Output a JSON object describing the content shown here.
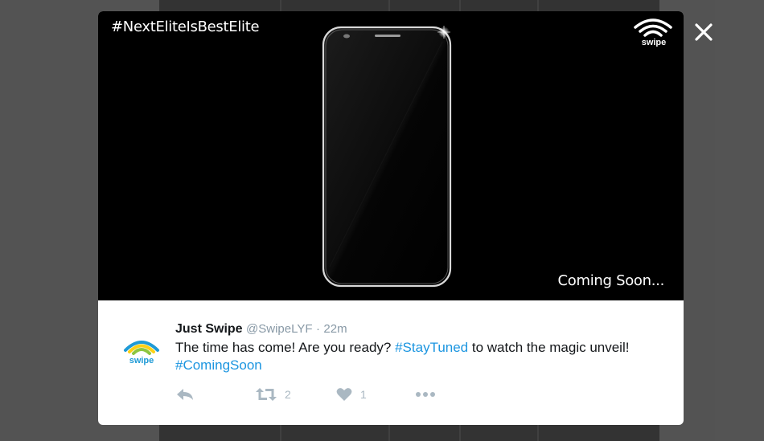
{
  "media": {
    "hashtag_overlay": "#NextEliteIsBestElite",
    "coming_soon": "Coming Soon...",
    "brand_logo_text": "swipe"
  },
  "tweet": {
    "avatar_text": "swipe",
    "user_name": "Just Swipe",
    "handle": "@SwipeLYF",
    "separator": "·",
    "time": "22m",
    "text_part1": "The time has come! Are you ready? ",
    "hashtag1": "#StayTuned",
    "text_part2": " to watch the magic unveil!",
    "hashtag2": "#ComingSoon",
    "retweet_count": "2",
    "like_count": "1"
  },
  "icons": {
    "close": "close-icon",
    "reply": "reply-icon",
    "retweet": "retweet-icon",
    "like": "heart-icon",
    "more": "more-icon"
  },
  "colors": {
    "link": "#1b95e0",
    "action_icon": "#aab8c2",
    "avatar_green": "#8dc63f",
    "avatar_yellow": "#fcd116",
    "avatar_blue": "#1e9ad6"
  }
}
